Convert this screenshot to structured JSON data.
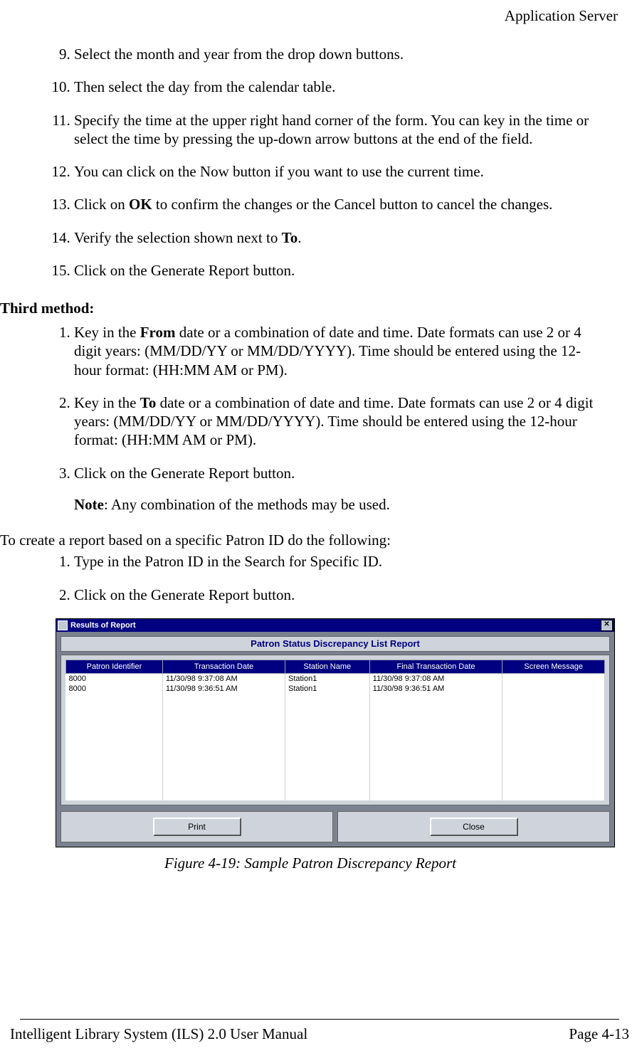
{
  "header": {
    "title": "Application Server"
  },
  "list_a": {
    "start": 9,
    "items": [
      {
        "text_before": "Select the month and year from the drop down buttons."
      },
      {
        "text_before": "Then select the day from the calendar table."
      },
      {
        "text_before": "Specify the time at the upper right hand corner of the form. You can key in the time or select the time by pressing the up-down arrow buttons at the end of the field."
      },
      {
        "text_before": "You can click on the Now button if you want to use the current time."
      },
      {
        "text_before": "Click on ",
        "bold": "OK",
        "text_after": " to confirm the changes or the Cancel button to cancel the changes."
      },
      {
        "text_before": "Verify the selection shown next to ",
        "bold": "To",
        "text_after": "."
      },
      {
        "text_before": "Click on the Generate Report button."
      }
    ]
  },
  "third_method_heading": "Third method:",
  "list_b": {
    "start": 1,
    "items": [
      {
        "text_before": "Key in the ",
        "bold": "From",
        "text_after": " date or a combination of date and time. Date formats can use 2 or 4 digit years: (MM/DD/YY or MM/DD/YYYY). Time should be entered using the 12-hour format: (HH:MM AM or PM)."
      },
      {
        "text_before": "Key in the ",
        "bold": "To",
        "text_after": " date or a combination of date and time. Date formats can use 2 or 4 digit years: (MM/DD/YY or MM/DD/YYYY). Time should be entered using the 12-hour format: (HH:MM AM or PM)."
      },
      {
        "text_before": "Click on the Generate Report button."
      }
    ]
  },
  "note": {
    "label": "Note",
    "text": ": Any combination of the methods may be used."
  },
  "paragraph_patron": "To create a report based on a specific Patron ID do the following:",
  "list_c": {
    "start": 1,
    "items": [
      {
        "text_before": "Type in the Patron ID in the Search for Specific ID."
      },
      {
        "text_before": "Click on the Generate Report button."
      }
    ]
  },
  "report_window": {
    "titlebar": "Results of Report",
    "close_glyph": "✕",
    "report_title": "Patron Status Discrepancy List Report",
    "columns": [
      "Patron Identifier",
      "Transaction Date",
      "Station Name",
      "Final Transaction Date",
      "Screen Message"
    ],
    "rows": [
      [
        "8000",
        "11/30/98 9:37:08 AM",
        "Station1",
        "11/30/98 9:37:08 AM",
        ""
      ],
      [
        "8000",
        "11/30/98 9:36:51 AM",
        "Station1",
        "11/30/98 9:36:51 AM",
        ""
      ]
    ],
    "buttons": {
      "print": "Print",
      "close": "Close"
    }
  },
  "figure_caption": "Figure 4-19: Sample Patron Discrepancy Report",
  "footer": {
    "left": "Intelligent Library System (ILS) 2.0 User Manual",
    "right": "Page 4-13"
  }
}
